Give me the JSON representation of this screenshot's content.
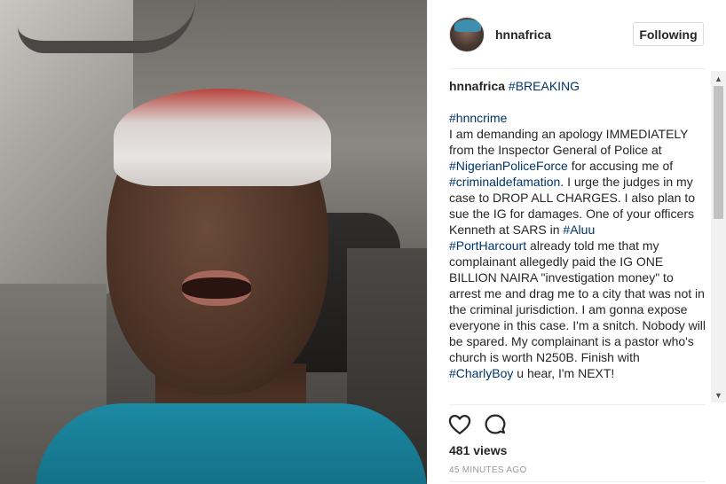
{
  "post": {
    "username": "hnnafrica",
    "follow_label": "Following",
    "caption": [
      {
        "t": "user",
        "v": "hnnafrica"
      },
      {
        "t": "text",
        "v": " "
      },
      {
        "t": "tag",
        "v": "#BREAKING"
      },
      {
        "t": "text",
        "v": "\n\n"
      },
      {
        "t": "tag",
        "v": "#hnncrime"
      },
      {
        "t": "text",
        "v": "\nI am demanding an apology IMMEDIATELY from the Inspector General of Police at "
      },
      {
        "t": "tag",
        "v": "#NigerianPoliceForce"
      },
      {
        "t": "text",
        "v": " for accusing me of "
      },
      {
        "t": "tag",
        "v": "#criminaldefamation"
      },
      {
        "t": "text",
        "v": ". I urge the judges in my case to DROP ALL CHARGES. I also plan to sue the IG for damages. One of your officers Kenneth at SARS in "
      },
      {
        "t": "tag",
        "v": "#Aluu"
      },
      {
        "t": "text",
        "v": "\n"
      },
      {
        "t": "tag",
        "v": "#PortHarcourt"
      },
      {
        "t": "text",
        "v": " already told me that my complainant allegedly paid the IG ONE BILLION NAIRA \"investigation money\" to arrest me and drag me to a city that was not in the criminal jurisdiction. I am gonna expose everyone in this case. I'm a snitch. Nobody will be spared. My complainant is a pastor who's church is worth N250B. Finish with "
      },
      {
        "t": "tag",
        "v": "#CharlyBoy"
      },
      {
        "t": "text",
        "v": " u hear, I'm NEXT!\n\n--"
      }
    ],
    "views": "481 views",
    "timestamp": "45 MINUTES AGO"
  },
  "icons": {
    "like": "heart-outline-icon",
    "comment": "comment-bubble-icon"
  },
  "colors": {
    "hashtag": "#003569",
    "text": "#262626",
    "muted": "#999999"
  }
}
